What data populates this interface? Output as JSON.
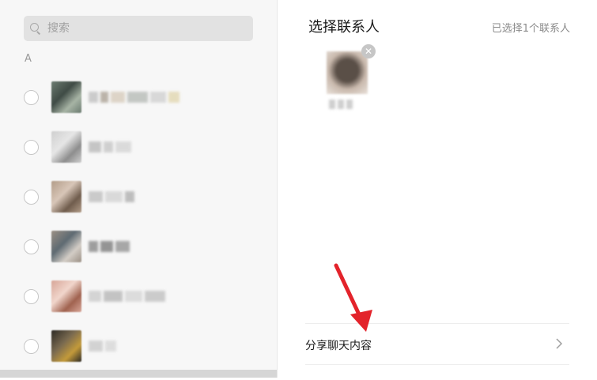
{
  "search": {
    "placeholder": "搜索",
    "value": ""
  },
  "contacts": {
    "group_letter": "A",
    "items": [
      {
        "avatar_colors": [
          "#6b7b70",
          "#a7b4a5",
          "#3f4b45"
        ],
        "name_blocks": [
          "#a8a8a8",
          "#8a7d6a",
          "#c8b8a0",
          "#9aa09a",
          "#bfbfbf",
          "#d8c890"
        ]
      },
      {
        "avatar_colors": [
          "#cfcfcf",
          "#8d8d8d",
          "#e6e6e6"
        ],
        "name_blocks": [
          "#9e9e9e",
          "#b0b0b0",
          "#c4c4c4"
        ]
      },
      {
        "avatar_colors": [
          "#b29c88",
          "#6f5c4c",
          "#d8c6b8"
        ],
        "name_blocks": [
          "#a6a6a6",
          "#c2c2c2",
          "#8f8f8f"
        ]
      },
      {
        "avatar_colors": [
          "#9a8f84",
          "#d3cdc6",
          "#5e6a72"
        ],
        "name_blocks": [
          "#555555",
          "#444444",
          "#666666"
        ]
      },
      {
        "avatar_colors": [
          "#d7a597",
          "#a0624f",
          "#f1d6cc"
        ],
        "name_blocks": [
          "#b8b8b8",
          "#9a9a9a",
          "#c6c6c6",
          "#a8a8a8"
        ]
      },
      {
        "avatar_colors": [
          "#2d2a25",
          "#c39a3a",
          "#7a6a50"
        ],
        "name_blocks": [
          "#b5b5b5",
          "#c9c9c9"
        ]
      }
    ]
  },
  "header": {
    "title": "选择联系人",
    "selected_count": "已选择1个联系人"
  },
  "selected": {
    "avatar_colors": [
      "#c9b9ad",
      "#5a4f47",
      "#e9e1da"
    ]
  },
  "share": {
    "label": "分享聊天内容"
  },
  "annotation": {
    "arrow_color": "#e3232b"
  }
}
